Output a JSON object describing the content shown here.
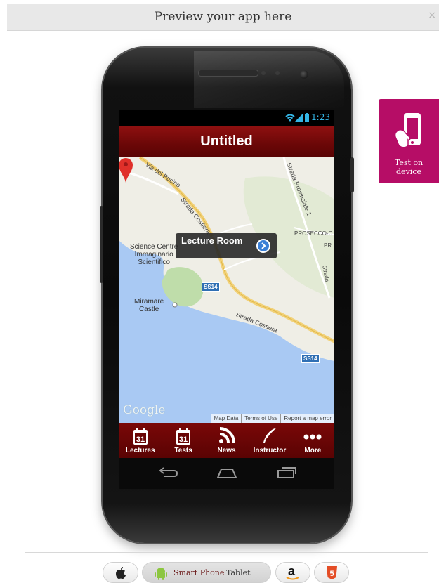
{
  "banner": {
    "title": "Preview your app here",
    "close": "×"
  },
  "device": {
    "status_time": "1:23",
    "app_title": "Untitled",
    "map": {
      "callout": "Lecture Room",
      "labels": {
        "via_pucino": "Via del Pucino",
        "strada_costiera_top": "Strada Costiera",
        "strada_provinciale": "Strada Provinciale 1",
        "prosecco": "PROSECCO-C",
        "pr": "PR",
        "science_centre": "Science Centre\nImmaginario\nScientifico",
        "miramare": "Miramare\nCastle",
        "strada_costiera": "Strada Costiera",
        "strada_right": "Strada"
      },
      "shields": [
        "SS14",
        "SS14"
      ],
      "google_logo": "Google",
      "footer": [
        "Map Data",
        "Terms of Use",
        "Report a map error"
      ]
    },
    "tabs": [
      {
        "label": "Lectures",
        "icon": "calendar-icon",
        "day": "31"
      },
      {
        "label": "Tests",
        "icon": "calendar-icon",
        "day": "31"
      },
      {
        "label": "News",
        "icon": "rss-icon"
      },
      {
        "label": "Instructor",
        "icon": "quill-icon"
      },
      {
        "label": "More",
        "icon": "more-dots-icon"
      }
    ]
  },
  "test_device": {
    "label": "Test on\ndevice",
    "icon": "touch-phone-icon"
  },
  "platform_bar": {
    "apple": {
      "icon": "apple-icon"
    },
    "android": {
      "icon": "android-icon",
      "phone_label": "Smart Phone",
      "tablet_label": "Tablet"
    },
    "amazon": {
      "icon": "amazon-icon",
      "glyph": "a"
    },
    "html5": {
      "icon": "html5-icon",
      "glyph": "5"
    }
  },
  "colors": {
    "header_red": "#7a0808",
    "status_blue": "#33b5e5",
    "test_device_magenta": "#b60d66"
  }
}
